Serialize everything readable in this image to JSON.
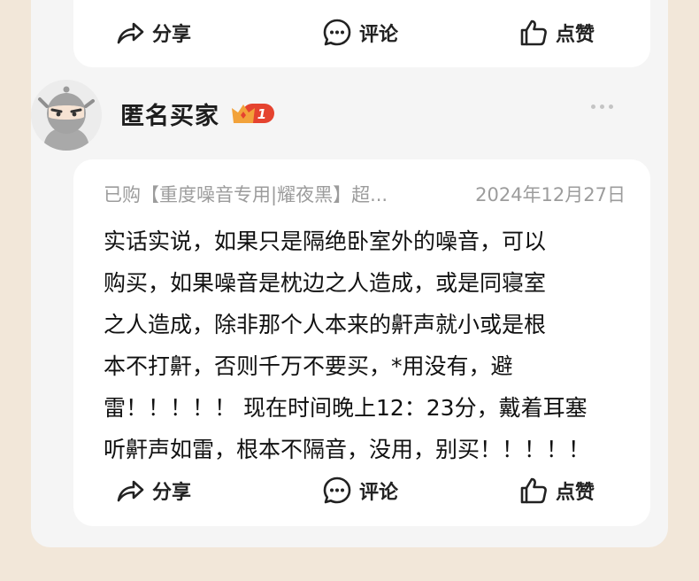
{
  "top_card": {
    "share_label": "分享",
    "comment_label": "评论",
    "like_label": "点赞"
  },
  "review": {
    "username": "匿名买家",
    "badge_level": "1",
    "product": "已购【重度噪音专用|耀夜黑】超...",
    "date": "2024年12月27日",
    "lines": [
      "实话实说，如果只是隔绝卧室外的噪音，可以",
      "购买，如果噪音是枕边之人造成，或是同寝室",
      "之人造成，除非那个人本来的鼾声就小或是根",
      "本不打鼾，否则千万不要买，*用没有，避",
      "雷！！！！！ 现在时间晚上12：23分，戴着耳塞",
      "听鼾声如雷，根本不隔音，没用，别买！！！！！"
    ],
    "share_label": "分享",
    "comment_label": "评论",
    "like_label": "点赞"
  },
  "icons": {
    "share": "share-arrow-icon",
    "comment": "chat-bubble-icon",
    "like": "thumbs-up-icon",
    "more": "more-dots-icon",
    "badge": "crown-badge-icon"
  },
  "colors": {
    "page_bg": "#f2e7d9",
    "panel_bg": "#f5f5f5",
    "card_bg": "#ffffff",
    "badge_orange": "#f2a23a",
    "badge_red": "#e5432f"
  }
}
